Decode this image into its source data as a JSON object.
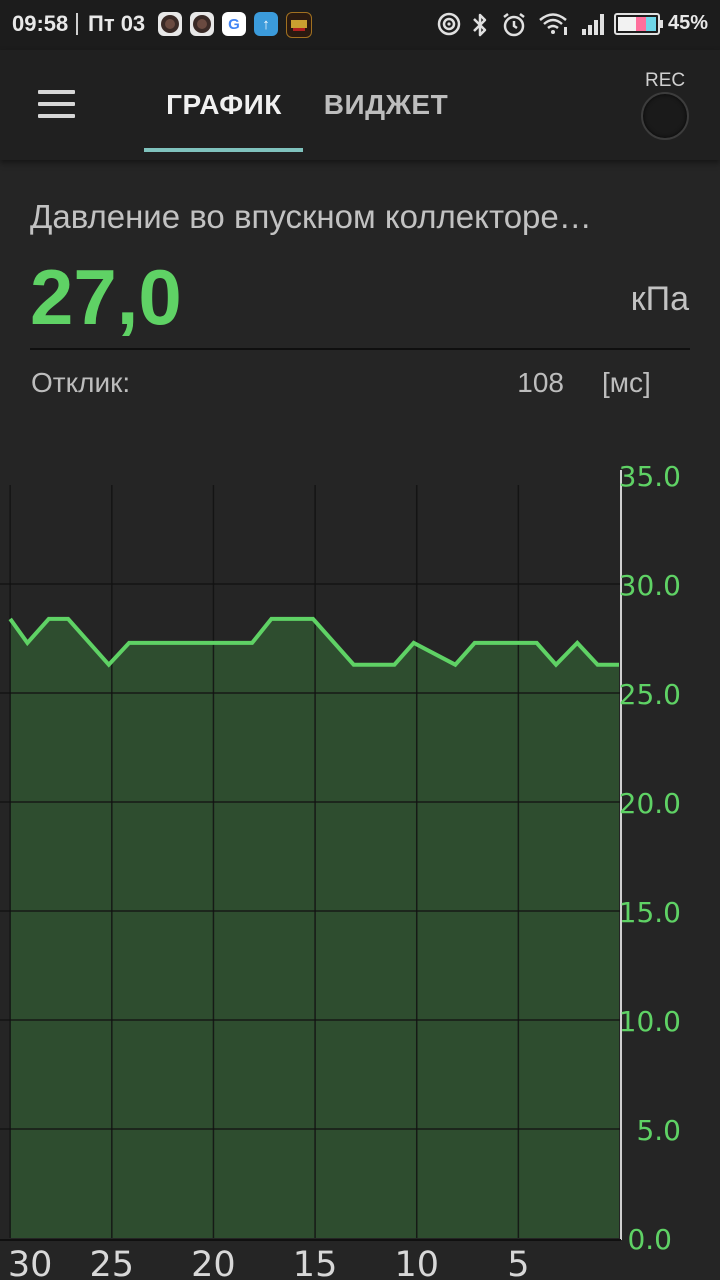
{
  "status_bar": {
    "time": "09:58",
    "day": "Пт 03",
    "battery": "45%",
    "icons": [
      "app-icon-1",
      "app-icon-2",
      "google-icon",
      "upload-icon",
      "obd-app-icon",
      "hotspot-icon",
      "bluetooth-icon",
      "alarm-icon",
      "wifi-icon",
      "signal-icon",
      "battery-icon"
    ]
  },
  "toolbar": {
    "tabs": [
      {
        "label": "ГРАФИК",
        "active": true
      },
      {
        "label": "ВИДЖЕТ",
        "active": false
      }
    ],
    "rec_label": "REC",
    "menu_icon": "hamburger-menu-icon"
  },
  "parameter": {
    "name": "Давление во впускном коллекторе…",
    "value": "27,0",
    "unit": "кПа",
    "response_label": "Отклик:",
    "response_value": "108",
    "response_unit": "[мс]"
  },
  "colors": {
    "accent": "#5fd265",
    "tab_indicator": "#7fc2bd",
    "fill": "#2e4d2f",
    "background": "#252525"
  },
  "chart_data": {
    "type": "area",
    "x_tick_labels": [
      "30",
      "25",
      "20",
      "15",
      "10",
      "5"
    ],
    "x_ticks": [
      30,
      25,
      20,
      15,
      10,
      5
    ],
    "x_range": [
      30.5,
      0
    ],
    "y_tick_labels": [
      "35.0",
      "30.0",
      "25.0",
      "20.0",
      "15.0",
      "10.0",
      "5.0",
      "0.0"
    ],
    "y_ticks": [
      35,
      30,
      25,
      20,
      15,
      10,
      5,
      0
    ],
    "ylim": [
      0,
      35
    ],
    "grid": true,
    "series": [
      {
        "x": [
          30,
          29.15,
          28.1,
          27.15,
          25.15,
          24.15,
          21.1,
          20.15,
          18.1,
          17.15,
          15.1,
          13.1,
          12.15,
          11.1,
          10.15,
          8.1,
          7.15,
          6.1,
          5.15,
          4.1,
          3.15,
          2.1,
          1.1,
          0.05
        ],
        "y": [
          28.4,
          27.3,
          28.4,
          28.4,
          26.3,
          27.3,
          27.3,
          27.3,
          27.3,
          28.4,
          28.4,
          26.3,
          26.3,
          26.3,
          27.3,
          26.3,
          27.3,
          27.3,
          27.3,
          27.3,
          26.3,
          27.3,
          26.3,
          26.3
        ]
      }
    ]
  }
}
